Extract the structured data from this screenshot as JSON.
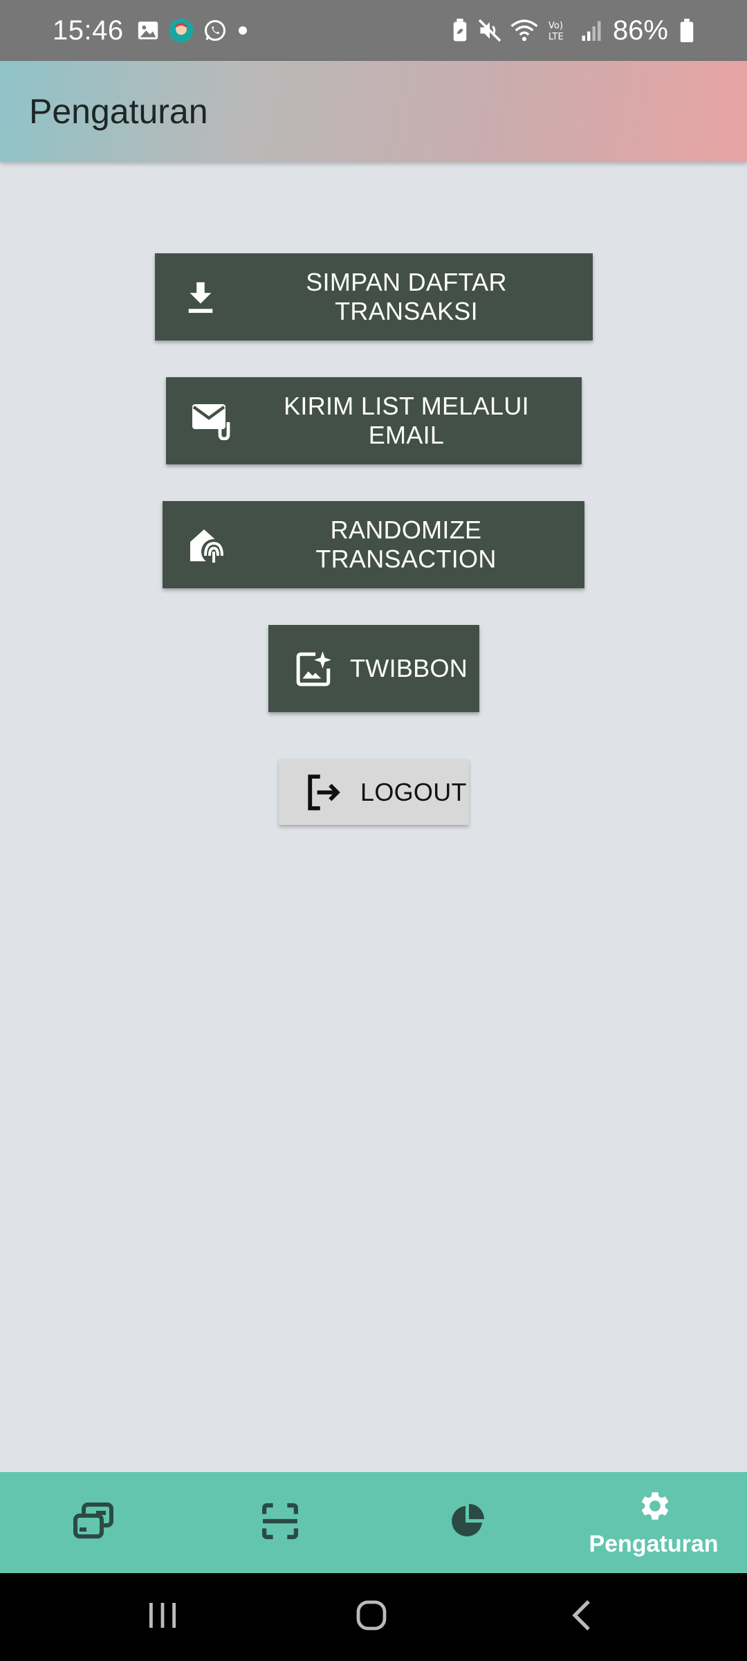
{
  "status_bar": {
    "time": "15:46",
    "battery_percent": "86%",
    "left_icons": [
      "image-icon",
      "avatar-icon",
      "whatsapp-icon",
      "dot-icon"
    ],
    "right_icons": [
      "battery-saver-icon",
      "mute-icon",
      "wifi-icon",
      "volte-icon",
      "signal-icon",
      "battery-icon"
    ]
  },
  "app_bar": {
    "title": "Pengaturan"
  },
  "actions": {
    "save_label": "SIMPAN DAFTAR TRANSAKSI",
    "email_label": "KIRIM LIST MELALUI EMAIL",
    "randomize_label": "RANDOMIZE TRANSACTION",
    "twibbon_label": "TWIBBON",
    "logout_label": "LOGOUT"
  },
  "bottom_nav": {
    "items": [
      {
        "icon": "transactions-icon",
        "label": ""
      },
      {
        "icon": "scan-icon",
        "label": ""
      },
      {
        "icon": "pie-chart-icon",
        "label": ""
      },
      {
        "icon": "gear-icon",
        "label": "Pengaturan",
        "active": true
      }
    ]
  },
  "colors": {
    "action_button": "#435048",
    "logout_button": "#d8d8d8",
    "bottom_nav": "#63c5ae",
    "nav_icon": "#2b4a44",
    "background": "#dfe3e7"
  }
}
